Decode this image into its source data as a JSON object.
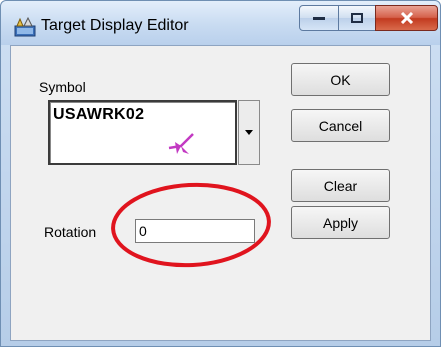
{
  "window": {
    "title": "Target Display Editor"
  },
  "symbol": {
    "label": "Symbol",
    "value": "USAWRK02",
    "glyph_color": "#c239c2"
  },
  "rotation": {
    "label": "Rotation",
    "value": "0"
  },
  "buttons": {
    "ok": "OK",
    "cancel": "Cancel",
    "clear": "Clear",
    "apply": "Apply"
  },
  "annotation": {
    "color": "#e0141e"
  }
}
